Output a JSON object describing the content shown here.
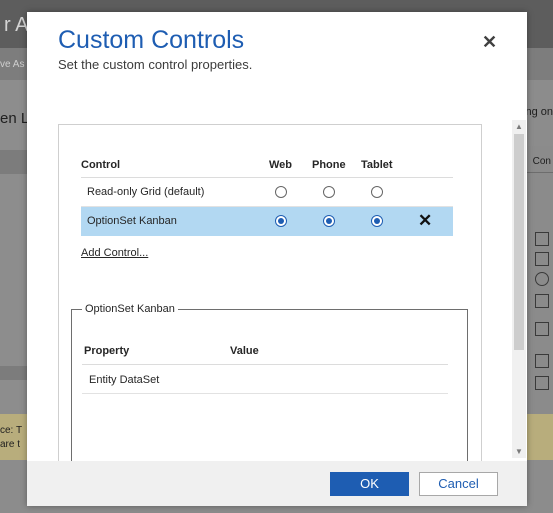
{
  "background": {
    "app_title_fragment": "r Ap",
    "subnav_fragment": "ve As",
    "left_title_fragment": "en L",
    "notice_fragment_1": "ce: T",
    "notice_fragment_2": "are t",
    "right_text_fragment": "ng on",
    "right_header_fragment": "Con"
  },
  "dialog": {
    "title": "Custom Controls",
    "subtitle": "Set the custom control properties.",
    "close_icon": "close-icon"
  },
  "controls_table": {
    "headers": {
      "control": "Control",
      "web": "Web",
      "phone": "Phone",
      "tablet": "Tablet"
    },
    "rows": [
      {
        "label": "Read-only Grid (default)",
        "web": false,
        "phone": false,
        "tablet": false,
        "selected": false
      },
      {
        "label": "OptionSet Kanban",
        "web": true,
        "phone": true,
        "tablet": true,
        "selected": true,
        "delete_icon": "delete-x-icon"
      }
    ],
    "add_link": "Add Control..."
  },
  "properties": {
    "legend": "OptionSet Kanban",
    "headers": {
      "property": "Property",
      "value": "Value"
    },
    "rows": [
      {
        "property": "Entity DataSet",
        "value": ""
      }
    ]
  },
  "footer": {
    "ok_label": "OK",
    "cancel_label": "Cancel"
  },
  "colors": {
    "accent": "#1e5db2",
    "selected_row": "#b2d8f2",
    "overlay": "#8c8c8c"
  }
}
